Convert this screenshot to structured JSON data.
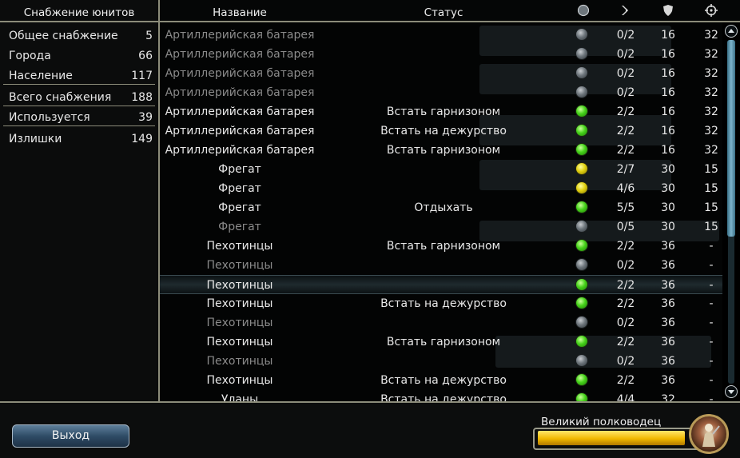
{
  "left_panel": {
    "title": "Снабжение юнитов",
    "stats": [
      {
        "label": "Общее снабжение",
        "value": "5"
      },
      {
        "label": "Города",
        "value": "66"
      },
      {
        "label": "Население",
        "value": "117"
      },
      {
        "label": "Всего снабжения",
        "value": "188"
      },
      {
        "label": "Используется",
        "value": "39"
      },
      {
        "label": "Излишки",
        "value": "149"
      }
    ]
  },
  "header": {
    "name": "Название",
    "status": "Статус",
    "icons": [
      "status-dot-icon",
      "moves-arrow-icon",
      "defense-shield-icon",
      "attack-crosshair-icon"
    ]
  },
  "units": [
    {
      "name": "Артиллерийская батарея",
      "status": "",
      "dot": "gray",
      "moves": "0/2",
      "def": "16",
      "atk": "32",
      "dim": true
    },
    {
      "name": "Артиллерийская батарея",
      "status": "",
      "dot": "gray",
      "moves": "0/2",
      "def": "16",
      "atk": "32",
      "dim": true
    },
    {
      "name": "Артиллерийская батарея",
      "status": "",
      "dot": "gray",
      "moves": "0/2",
      "def": "16",
      "atk": "32",
      "dim": true
    },
    {
      "name": "Артиллерийская батарея",
      "status": "",
      "dot": "gray",
      "moves": "0/2",
      "def": "16",
      "atk": "32",
      "dim": true
    },
    {
      "name": "Артиллерийская батарея",
      "status": "Встать гарнизоном",
      "dot": "green",
      "moves": "2/2",
      "def": "16",
      "atk": "32",
      "dim": false
    },
    {
      "name": "Артиллерийская батарея",
      "status": "Встать на дежурство",
      "dot": "green",
      "moves": "2/2",
      "def": "16",
      "atk": "32",
      "dim": false
    },
    {
      "name": "Артиллерийская батарея",
      "status": "Встать гарнизоном",
      "dot": "green",
      "moves": "2/2",
      "def": "16",
      "atk": "32",
      "dim": false
    },
    {
      "name": "Фрегат",
      "status": "",
      "dot": "yellow",
      "moves": "2/7",
      "def": "30",
      "atk": "15",
      "dim": false
    },
    {
      "name": "Фрегат",
      "status": "",
      "dot": "yellow",
      "moves": "4/6",
      "def": "30",
      "atk": "15",
      "dim": false
    },
    {
      "name": "Фрегат",
      "status": "Отдыхать",
      "dot": "green",
      "moves": "5/5",
      "def": "30",
      "atk": "15",
      "dim": false
    },
    {
      "name": "Фрегат",
      "status": "",
      "dot": "gray",
      "moves": "0/5",
      "def": "30",
      "atk": "15",
      "dim": true
    },
    {
      "name": "Пехотинцы",
      "status": "Встать гарнизоном",
      "dot": "green",
      "moves": "2/2",
      "def": "36",
      "atk": "-",
      "dim": false
    },
    {
      "name": "Пехотинцы",
      "status": "",
      "dot": "gray",
      "moves": "0/2",
      "def": "36",
      "atk": "-",
      "dim": true
    },
    {
      "name": "Пехотинцы",
      "status": "",
      "dot": "green",
      "moves": "2/2",
      "def": "36",
      "atk": "-",
      "dim": false,
      "selected": true
    },
    {
      "name": "Пехотинцы",
      "status": "Встать на дежурство",
      "dot": "green",
      "moves": "2/2",
      "def": "36",
      "atk": "-",
      "dim": false
    },
    {
      "name": "Пехотинцы",
      "status": "",
      "dot": "gray",
      "moves": "0/2",
      "def": "36",
      "atk": "-",
      "dim": true
    },
    {
      "name": "Пехотинцы",
      "status": "Встать гарнизоном",
      "dot": "green",
      "moves": "2/2",
      "def": "36",
      "atk": "-",
      "dim": false
    },
    {
      "name": "Пехотинцы",
      "status": "",
      "dot": "gray",
      "moves": "0/2",
      "def": "36",
      "atk": "-",
      "dim": true
    },
    {
      "name": "Пехотинцы",
      "status": "Встать на дежурство",
      "dot": "green",
      "moves": "2/2",
      "def": "36",
      "atk": "-",
      "dim": false
    },
    {
      "name": "Уланы",
      "status": "Встать на дежурство",
      "dot": "green",
      "moves": "4/4",
      "def": "32",
      "atk": "-",
      "dim": false
    }
  ],
  "bottom": {
    "exit_label": "Выход",
    "leader_label": "Великий полководец",
    "leader_progress": 0.93
  },
  "colors": {
    "dot_green": "#46d21a",
    "dot_yellow": "#e0d010",
    "dot_gray": "#6e767c",
    "progress": "#f0b800",
    "frame": "#8c8c7a"
  }
}
